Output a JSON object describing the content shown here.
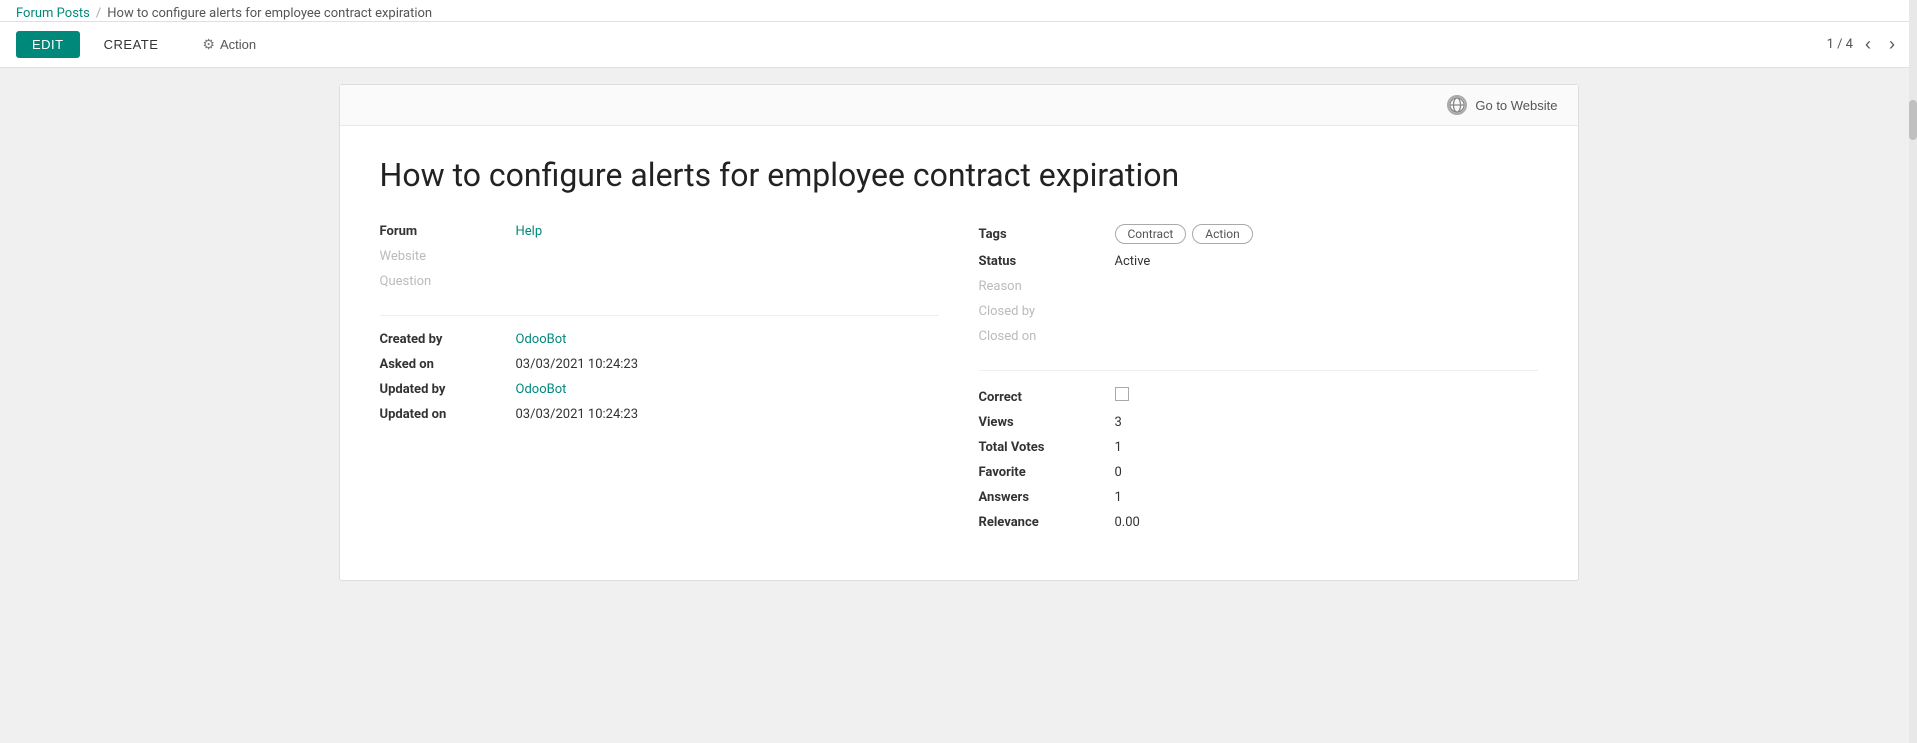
{
  "breadcrumb": {
    "parent_label": "Forum Posts",
    "separator": "/",
    "current": "How to configure alerts for employee contract expiration"
  },
  "toolbar": {
    "edit_label": "EDIT",
    "create_label": "CREATE",
    "action_label": "Action",
    "pagination": "1 / 4"
  },
  "go_to_website": {
    "label": "Go to Website"
  },
  "post": {
    "title": "How to configure alerts for employee contract expiration",
    "left": {
      "forum_label": "Forum",
      "forum_value": "Help",
      "website_label": "Website",
      "question_label": "Question",
      "created_by_label": "Created by",
      "created_by_value": "OdooBot",
      "asked_on_label": "Asked on",
      "asked_on_value": "03/03/2021 10:24:23",
      "updated_by_label": "Updated by",
      "updated_by_value": "OdooBot",
      "updated_on_label": "Updated on",
      "updated_on_value": "03/03/2021 10:24:23"
    },
    "right": {
      "tags_label": "Tags",
      "tags": [
        "Contract",
        "Action"
      ],
      "status_label": "Status",
      "status_value": "Active",
      "reason_label": "Reason",
      "closed_by_label": "Closed by",
      "closed_on_label": "Closed on",
      "correct_label": "Correct",
      "views_label": "Views",
      "views_value": "3",
      "total_votes_label": "Total Votes",
      "total_votes_value": "1",
      "favorite_label": "Favorite",
      "favorite_value": "0",
      "answers_label": "Answers",
      "answers_value": "1",
      "relevance_label": "Relevance",
      "relevance_value": "0.00"
    }
  }
}
